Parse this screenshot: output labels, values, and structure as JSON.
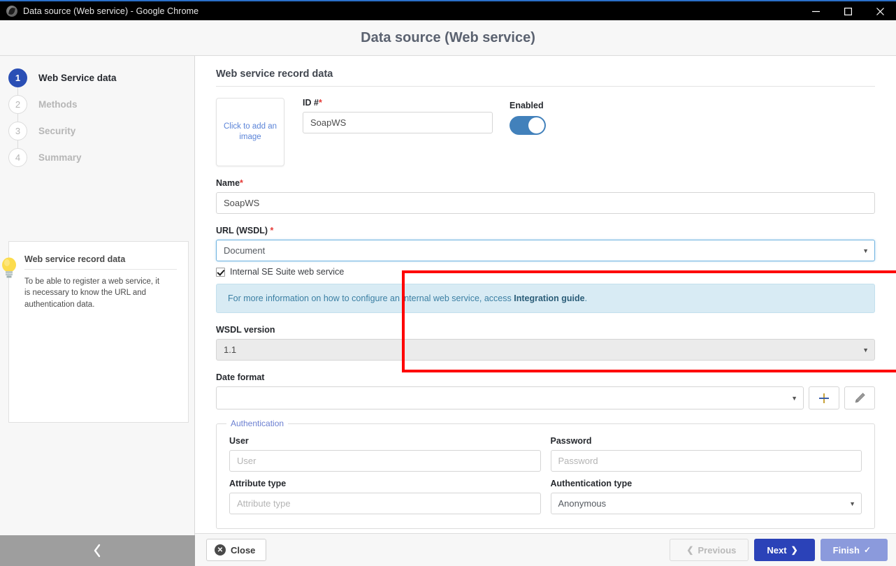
{
  "window": {
    "title": "Data source (Web service) - Google Chrome",
    "icon": "globe-icon",
    "minimize_label": "Minimize",
    "maximize_label": "Maximize",
    "close_label": "Close"
  },
  "header": {
    "title": "Data source (Web service)"
  },
  "sidebar": {
    "steps": [
      {
        "number": "1",
        "label": "Web Service data",
        "state": "active"
      },
      {
        "number": "2",
        "label": "Methods",
        "state": "inactive"
      },
      {
        "number": "3",
        "label": "Security",
        "state": "inactive"
      },
      {
        "number": "4",
        "label": "Summary",
        "state": "inactive"
      }
    ],
    "tip": {
      "title": "Web service record data",
      "text": "To be able to register a web service, it is necessary to know the URL and authentication data."
    },
    "collapse_icon": "chevron-left-icon"
  },
  "main": {
    "section_title": "Web service record data",
    "image_placeholder": "Click to add an image",
    "id": {
      "label": "ID #",
      "required": "*",
      "value": "SoapWS"
    },
    "enabled": {
      "label": "Enabled",
      "state": "on"
    },
    "name": {
      "label": "Name",
      "required": "*",
      "value": "SoapWS"
    },
    "url_wsdl": {
      "label": "URL (WSDL)",
      "required": "*",
      "value": "Document",
      "caret": "▼"
    },
    "internal_checkbox": {
      "label": "Internal SE Suite web service",
      "checked": true
    },
    "info_message": {
      "prefix": "For more information on how to configure an internal web service, access ",
      "link": "Integration guide",
      "suffix": "."
    },
    "wsdl_version": {
      "label": "WSDL version",
      "value": "1.1",
      "caret": "▼"
    },
    "date_format": {
      "label": "Date format",
      "value": "",
      "caret": "▼",
      "add_icon": "plus-icon",
      "edit_icon": "pencil-icon"
    },
    "authentication": {
      "legend": "Authentication",
      "user": {
        "label": "User",
        "placeholder": "User",
        "value": ""
      },
      "password": {
        "label": "Password",
        "placeholder": "Password",
        "value": ""
      },
      "attribute_type": {
        "label": "Attribute type",
        "placeholder": "Attribute type",
        "value": ""
      },
      "authentication_type": {
        "label": "Authentication type",
        "value": "Anonymous",
        "caret": "▼"
      }
    }
  },
  "footer": {
    "close": "Close",
    "close_icon": "x-circle-icon",
    "previous": "Previous",
    "previous_icon": "chevron-left-icon",
    "next": "Next",
    "next_icon": "chevron-right-icon",
    "finish": "Finish",
    "finish_icon": "check-icon"
  },
  "colors": {
    "accent_blue": "#2b42b8",
    "finish_blue": "#8b9adc",
    "toggle_blue": "#4281bb",
    "annotation_red": "#fe0000",
    "info_bg": "#d8ebf4",
    "link_blue": "#5b84d8"
  }
}
